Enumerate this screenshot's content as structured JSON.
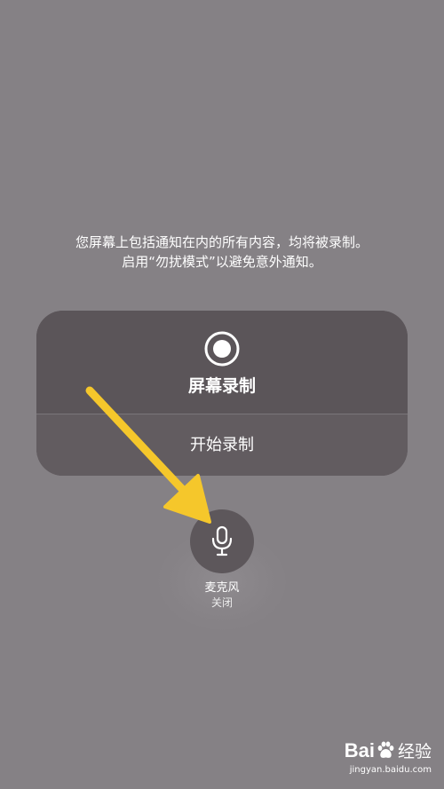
{
  "notice": {
    "line1": "您屏幕上包括通知在内的所有内容，均将被录制。",
    "line2": "启用“勿扰模式”以避免意外通知。"
  },
  "recording_card": {
    "title": "屏幕录制",
    "start_label": "开始录制",
    "icon": "record-icon"
  },
  "microphone": {
    "label": "麦克风",
    "status": "关闭",
    "icon": "microphone-icon"
  },
  "annotation": {
    "arrow_color": "#f5c72b",
    "icon": "arrow-annotation"
  },
  "watermark": {
    "logo_left": "Bai",
    "logo_right": "经验",
    "url": "jingyan.baidu.com"
  }
}
